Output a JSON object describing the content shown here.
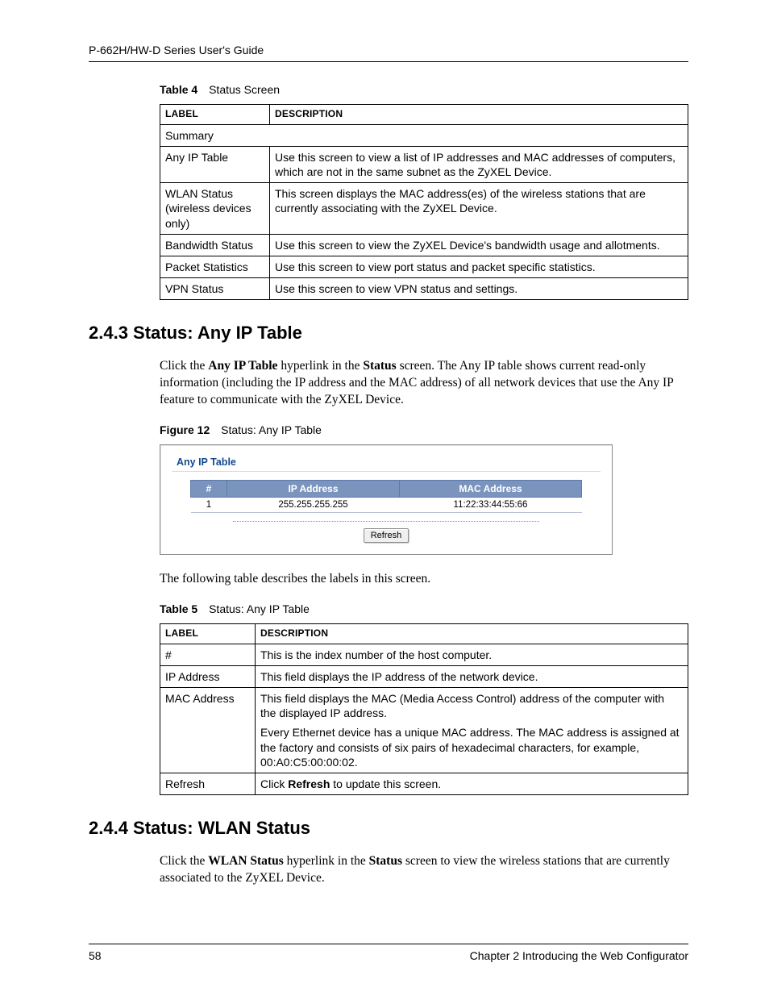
{
  "header": {
    "title": "P-662H/HW-D Series User's Guide"
  },
  "table4": {
    "caption_label": "Table 4",
    "caption_title": "Status Screen",
    "head": {
      "label": "LABEL",
      "desc": "DESCRIPTION"
    },
    "summary_row": "Summary",
    "rows": [
      {
        "label": "Any IP Table",
        "desc": "Use this screen to view a list of IP addresses and MAC addresses of computers, which are not in the same subnet as the ZyXEL Device."
      },
      {
        "label": "WLAN Status (wireless devices only)",
        "desc": "This screen displays the MAC address(es) of the wireless stations that are currently associating with the ZyXEL Device."
      },
      {
        "label": "Bandwidth Status",
        "desc": "Use this screen to view the ZyXEL Device's bandwidth usage and allotments."
      },
      {
        "label": "Packet Statistics",
        "desc": "Use this screen to view port status and packet specific statistics."
      },
      {
        "label": "VPN Status",
        "desc": "Use this screen to view VPN status and settings."
      }
    ]
  },
  "section_243": {
    "heading": "2.4.3  Status: Any IP Table",
    "para_parts": {
      "a": "Click the ",
      "b": "Any IP Table",
      "c": " hyperlink in the ",
      "d": "Status",
      "e": " screen. The Any IP table shows current read-only information (including the IP address and the MAC address) of all network devices that use the Any IP feature to communicate with the ZyXEL Device."
    },
    "followup": "The following table describes the labels in this screen."
  },
  "figure12": {
    "caption_label": "Figure 12",
    "caption_title": "Status: Any IP Table",
    "panel_title": "Any IP Table",
    "head": {
      "idx": "#",
      "ip": "IP Address",
      "mac": "MAC Address"
    },
    "row": {
      "idx": "1",
      "ip": "255.255.255.255",
      "mac": "11:22:33:44:55:66"
    },
    "refresh_label": "Refresh"
  },
  "table5": {
    "caption_label": "Table 5",
    "caption_title": "Status: Any IP Table",
    "head": {
      "label": "LABEL",
      "desc": "DESCRIPTION"
    },
    "rows": [
      {
        "label": "#",
        "desc": "This is the index number of the host computer."
      },
      {
        "label": "IP Address",
        "desc": "This field displays the IP address of the network device."
      },
      {
        "label": "MAC Address",
        "desc1": "This field displays the MAC (Media Access Control) address of the computer with the displayed IP address.",
        "desc2": "Every Ethernet device has a unique MAC address. The MAC address is assigned at the factory and consists of six pairs of hexadecimal characters, for example, 00:A0:C5:00:00:02."
      },
      {
        "label": "Refresh",
        "desc_a": "Click ",
        "desc_b": "Refresh",
        "desc_c": " to update this screen."
      }
    ]
  },
  "section_244": {
    "heading": "2.4.4  Status: WLAN Status",
    "para_parts": {
      "a": "Click the ",
      "b": "WLAN Status",
      "c": " hyperlink in the ",
      "d": "Status",
      "e": " screen to view the wireless stations that are currently associated to the ZyXEL Device."
    }
  },
  "footer": {
    "page": "58",
    "chapter": "Chapter 2 Introducing the Web Configurator"
  }
}
